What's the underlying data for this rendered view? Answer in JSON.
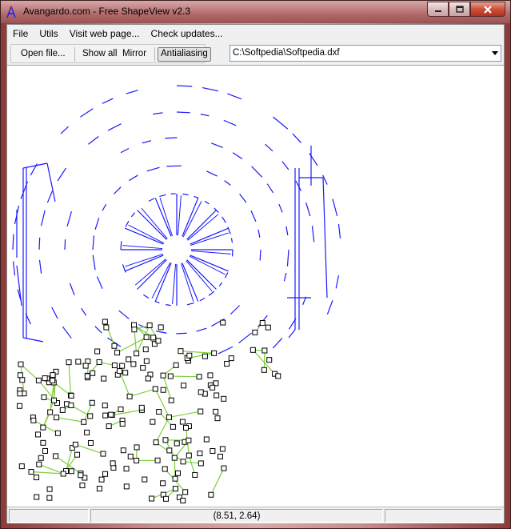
{
  "window": {
    "title": "Avangardo.com - Free ShapeView v2.3"
  },
  "menu": {
    "items": [
      "File",
      "Utils",
      "Visit web page...",
      "Check updates..."
    ]
  },
  "toolbar": {
    "open_file": "Open file...",
    "show_all": "Show all",
    "mirror": "Mirror",
    "antialiasing": "Antialiasing",
    "antialiasing_pressed": true,
    "file_path": "C:\\Softpedia\\Softpedia.dxf"
  },
  "status": {
    "left": "",
    "coordinates": "(8.51, 2.64)",
    "right": ""
  },
  "colors": {
    "drawing_lines": "#1a1aff",
    "drawing_links": "#7fcf3a",
    "drawing_nodes": "#000000"
  },
  "icons": {
    "app": "compass-icon",
    "minimize": "minimize-icon",
    "maximize": "maximize-icon",
    "close": "close-icon",
    "dropdown": "chevron-down-icon"
  }
}
